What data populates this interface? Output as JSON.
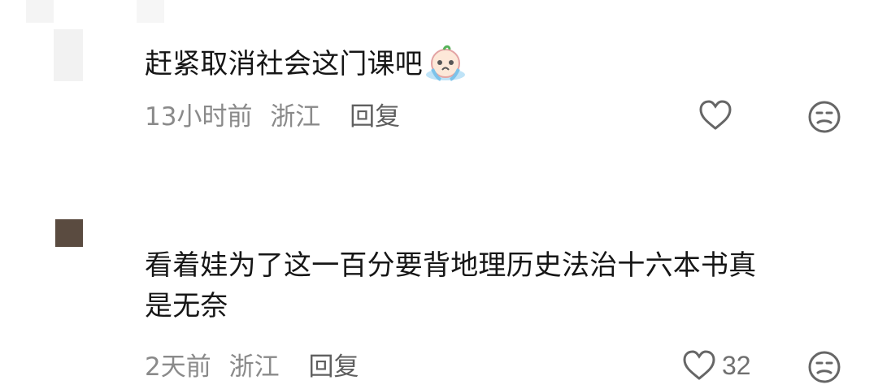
{
  "comments": [
    {
      "text": "赶紧取消社会这门课吧",
      "emoji": "crying-emoji",
      "time": "13小时前",
      "location": "浙江",
      "reply_label": "回复",
      "like_count": "",
      "icons": {
        "like": "heart-outline-icon",
        "dislike": "unamused-face-icon"
      },
      "avatar_color": "#f2f2f2"
    },
    {
      "text_line1": "看着娃为了这一百分要背地理历史法治十六本书真",
      "text_line2": "是无奈",
      "time": "2天前",
      "location": "浙江",
      "reply_label": "回复",
      "like_count": "32",
      "icons": {
        "like": "heart-outline-icon",
        "dislike": "unamused-face-icon"
      },
      "avatar_color": "#5a4b40"
    }
  ],
  "colors": {
    "text": "#161616",
    "meta": "#8a8a8a",
    "icon": "#666666"
  }
}
